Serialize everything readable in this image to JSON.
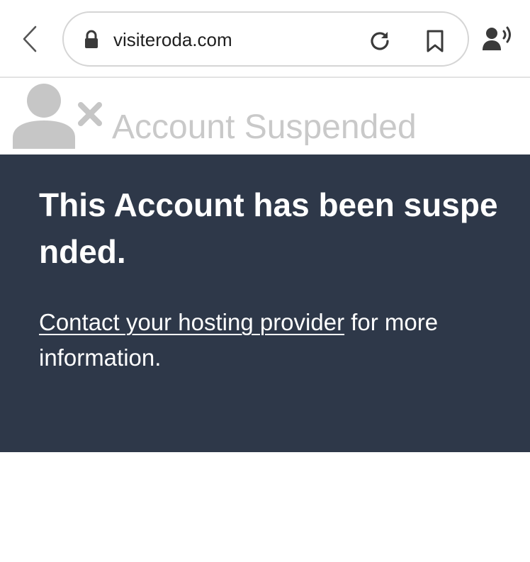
{
  "browser": {
    "url": "visiteroda.com",
    "icons": {
      "back": "chevron-left-icon",
      "lock": "lock-icon",
      "reload": "reload-icon",
      "bookmark": "bookmark-icon",
      "voice": "voice-speaking-icon"
    }
  },
  "page": {
    "header_title": "Account Suspended",
    "header_icon": "user-x-icon",
    "heading": "This Account has been suspended.",
    "link_text": "Contact your hosting provider",
    "body_suffix": " for more information."
  },
  "colors": {
    "panel_background": "#2e3849",
    "header_title": "#c9c9c9",
    "icon_gray": "#c6c6c6"
  }
}
